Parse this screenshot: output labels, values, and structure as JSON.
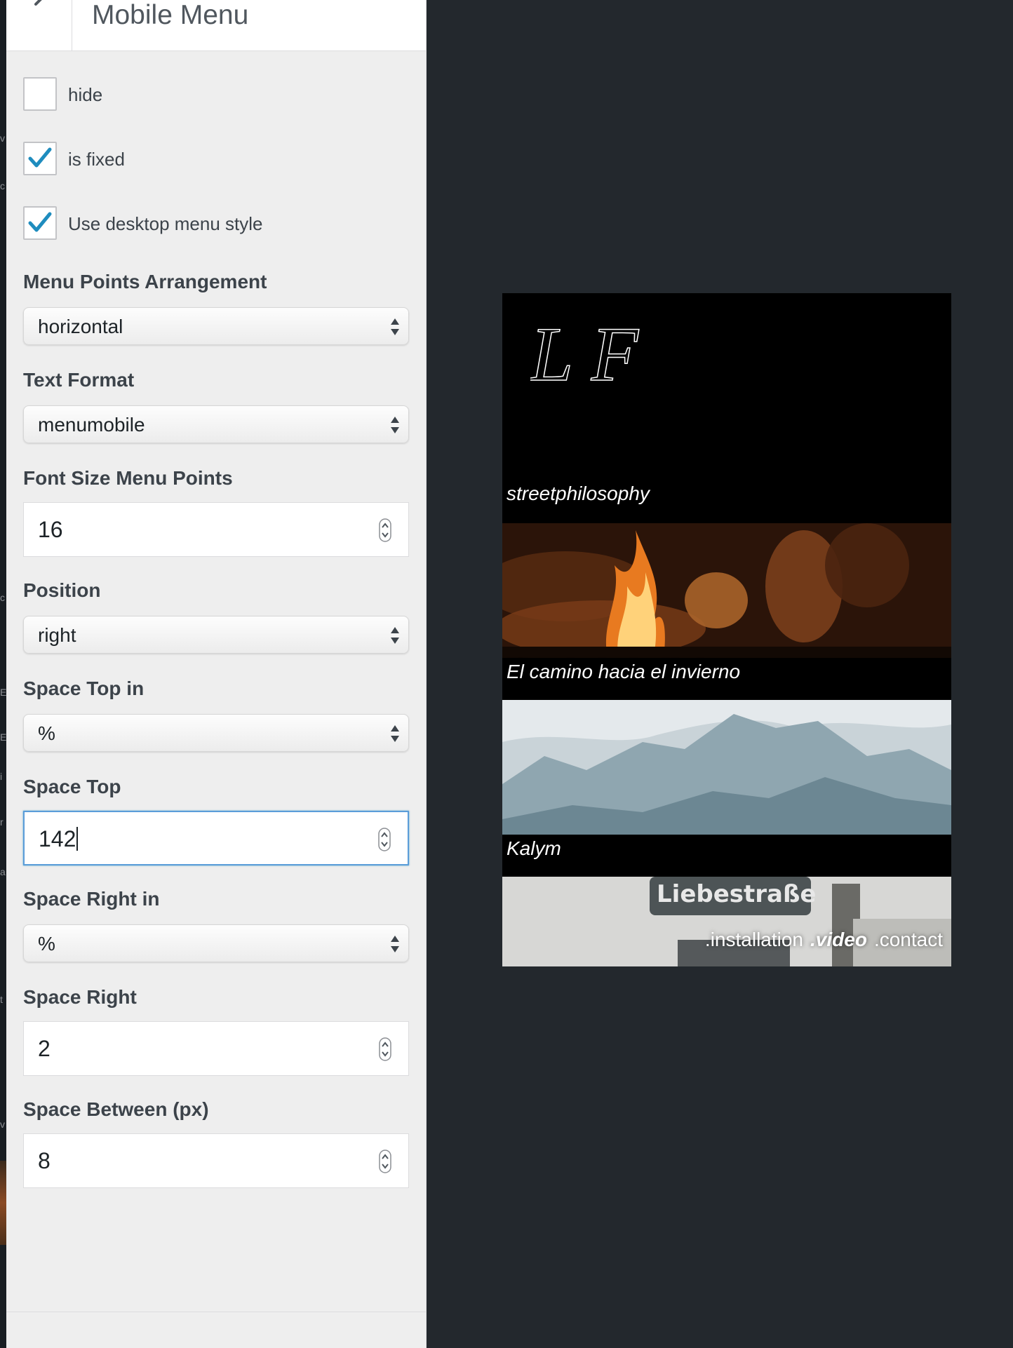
{
  "panel": {
    "title": "Mobile Menu",
    "checkboxes": [
      {
        "label": "hide",
        "checked": false
      },
      {
        "label": "is fixed",
        "checked": true
      },
      {
        "label": "Use desktop menu style",
        "checked": true
      }
    ],
    "fields": {
      "arrangement": {
        "label": "Menu Points Arrangement",
        "value": "horizontal"
      },
      "text_format": {
        "label": "Text Format",
        "value": "menumobile"
      },
      "font_size": {
        "label": "Font Size Menu Points",
        "value": "16"
      },
      "position": {
        "label": "Position",
        "value": "right"
      },
      "space_top_unit": {
        "label": "Space Top in",
        "value": "%"
      },
      "space_top": {
        "label": "Space Top",
        "value": "142"
      },
      "space_right_unit": {
        "label": "Space Right in",
        "value": "%"
      },
      "space_right": {
        "label": "Space Right",
        "value": "2"
      },
      "space_between": {
        "label": "Space Between (px)",
        "value": "8"
      }
    },
    "accent_color": "#1e8cbe",
    "focus_color": "#5b9dd9"
  },
  "edge": {
    "letters": [
      "v",
      "c",
      "E",
      "E",
      "r",
      "i",
      "t",
      "a",
      "c",
      "v"
    ]
  },
  "preview": {
    "logo": "L F",
    "menu_items": [
      {
        "label": "streetphilosophy"
      },
      {
        "label": "El camino hacia el invierno"
      },
      {
        "label": "Kalym"
      }
    ],
    "bottom_nav": [
      ".installation",
      ".video",
      ".contact"
    ],
    "active_nav": ".video",
    "sign_text": "Liebestraße"
  }
}
